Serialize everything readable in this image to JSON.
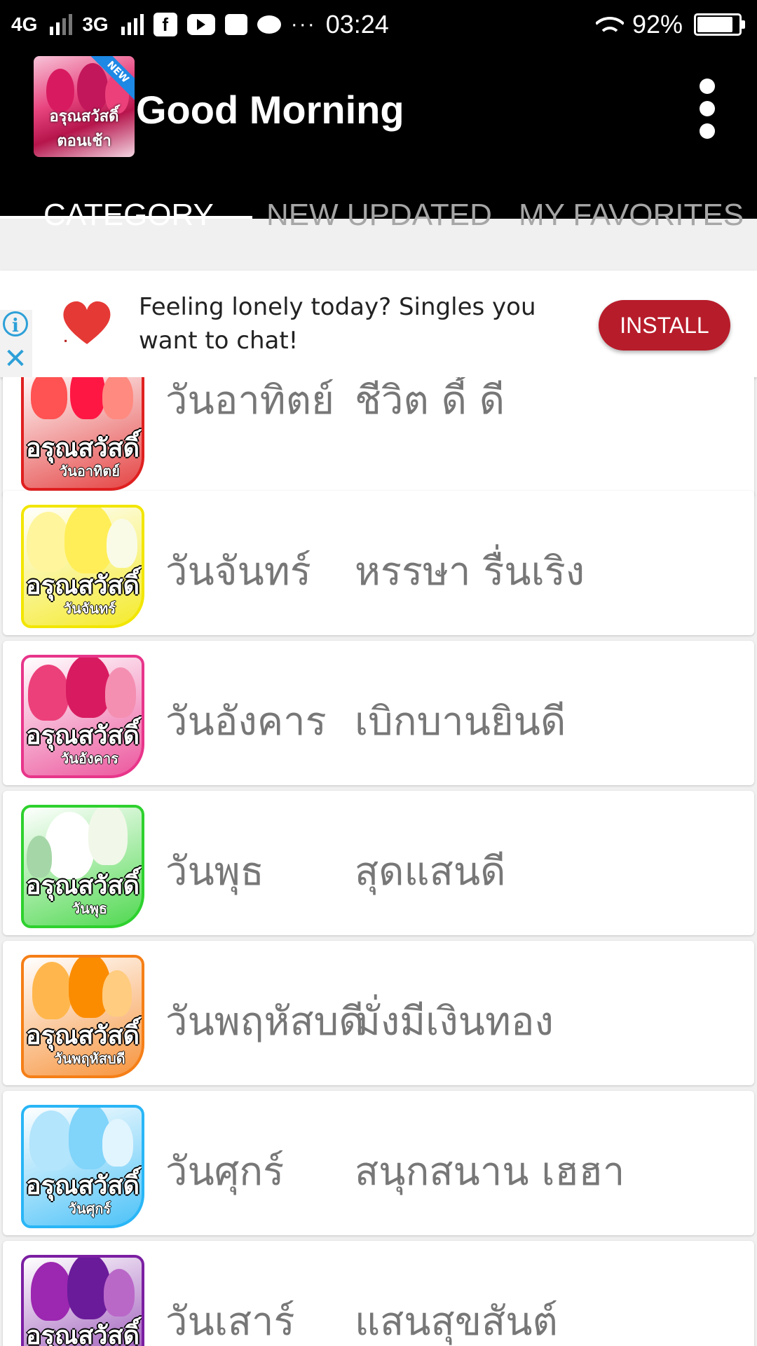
{
  "status_bar": {
    "network_1": "4G",
    "network_2": "3G",
    "facebook_glyph": "f",
    "overflow_glyph": "···",
    "time": "03:24",
    "battery_text": "92%",
    "battery_level": 0.92,
    "icons": [
      "signal-icon",
      "facebook-icon",
      "youtube-icon",
      "message-icon",
      "chat-icon",
      "wifi-icon",
      "battery-icon"
    ]
  },
  "app_bar": {
    "title": "Good Morning",
    "logo_badge": "NEW",
    "logo_text": "อรุณสวัสดิ์ ตอนเช้า"
  },
  "tabs": [
    {
      "label": "CATEGORY",
      "active": true
    },
    {
      "label": "NEW UPDATED",
      "active": false
    },
    {
      "label": "MY FAVORITES",
      "active": false
    }
  ],
  "ad": {
    "text": "Feeling lonely today? Singles you want to chat!",
    "button": "INSTALL",
    "info_glyph": "i",
    "close_glyph": "✕",
    "colors": {
      "button": "#b71c2a",
      "badge": "#2da0d8"
    }
  },
  "categories": [
    {
      "thumb_title": "อรุณสวัสดิ์",
      "thumb_day": "วันอาทิตย์",
      "day": "วันอาทิตย์",
      "blessing": "ชีวิต ดี้ ดี",
      "color": "#e02020"
    },
    {
      "thumb_title": "อรุณสวัสดิ์",
      "thumb_day": "วันจันทร์",
      "day": "วันจันทร์",
      "blessing": "หรรษา รื่นเริง",
      "color": "#f2e600"
    },
    {
      "thumb_title": "อรุณสวัสดิ์",
      "thumb_day": "วันอังคาร",
      "day": "วันอังคาร",
      "blessing": "เบิกบานยินดี",
      "color": "#e8358a"
    },
    {
      "thumb_title": "อรุณสวัสดิ์",
      "thumb_day": "วันพุธ",
      "day": "วันพุธ",
      "blessing": "สุดแสนดี",
      "color": "#2ed12e"
    },
    {
      "thumb_title": "อรุณสวัสดิ์",
      "thumb_day": "วันพฤหัสบดี",
      "day": "วันพฤหัสบดี",
      "blessing": "มั่งมีเงินทอง",
      "color": "#f57f17"
    },
    {
      "thumb_title": "อรุณสวัสดิ์",
      "thumb_day": "วันศุกร์",
      "day": "วันศุกร์",
      "blessing": "สนุกสนาน เฮฮา",
      "color": "#29b6f6"
    },
    {
      "thumb_title": "อรุณสวัสดิ์",
      "thumb_day": "",
      "day": "วันเสาร์",
      "blessing": "แสนสุขสันต์",
      "color": "#7b1fa2"
    }
  ]
}
